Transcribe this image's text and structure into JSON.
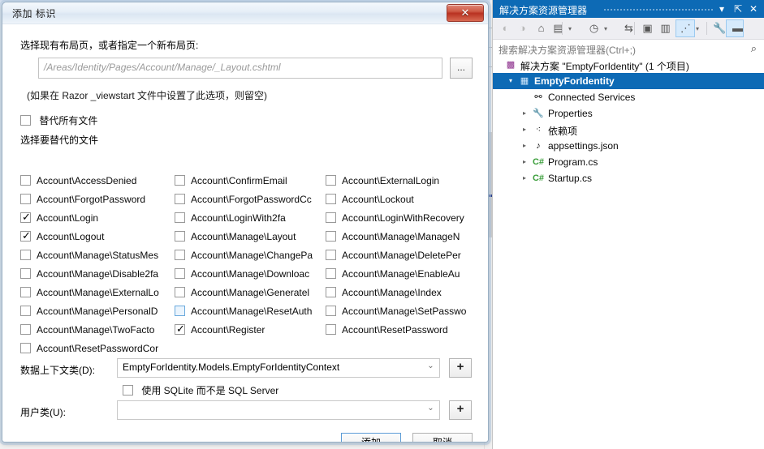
{
  "dialog": {
    "title": "添加 标识",
    "close_label": "✕",
    "layout_label": "选择现有布局页，或者指定一个新布局页:",
    "layout_placeholder": "/Areas/Identity/Pages/Account/Manage/_Layout.cshtml",
    "browse_label": "...",
    "layout_hint": "(如果在 Razor _viewstart 文件中设置了此选项，则留空)",
    "override_all_label": "替代所有文件",
    "override_all_checked": false,
    "select_files_label": "选择要替代的文件",
    "files": [
      {
        "label": "Account\\AccessDenied",
        "checked": false,
        "col": 0,
        "row": 0
      },
      {
        "label": "Account\\ForgotPassword",
        "checked": false,
        "col": 0,
        "row": 1
      },
      {
        "label": "Account\\Login",
        "checked": true,
        "col": 0,
        "row": 2
      },
      {
        "label": "Account\\Logout",
        "checked": true,
        "col": 0,
        "row": 3
      },
      {
        "label": "Account\\Manage\\StatusMes",
        "checked": false,
        "col": 0,
        "row": 4
      },
      {
        "label": "Account\\Manage\\Disable2fa",
        "checked": false,
        "col": 0,
        "row": 5
      },
      {
        "label": "Account\\Manage\\ExternalLo",
        "checked": false,
        "col": 0,
        "row": 6
      },
      {
        "label": "Account\\Manage\\PersonalD",
        "checked": false,
        "col": 0,
        "row": 7
      },
      {
        "label": "Account\\Manage\\TwoFacto",
        "checked": false,
        "col": 0,
        "row": 8
      },
      {
        "label": "Account\\ResetPasswordCor",
        "checked": false,
        "col": 0,
        "row": 9
      },
      {
        "label": "Account\\ConfirmEmail",
        "checked": false,
        "col": 1,
        "row": 0
      },
      {
        "label": "Account\\ForgotPasswordCc",
        "checked": false,
        "col": 1,
        "row": 1
      },
      {
        "label": "Account\\LoginWith2fa",
        "checked": false,
        "col": 1,
        "row": 2
      },
      {
        "label": "Account\\Manage\\Layout",
        "checked": false,
        "col": 1,
        "row": 3
      },
      {
        "label": "Account\\Manage\\ChangePa",
        "checked": false,
        "col": 1,
        "row": 4
      },
      {
        "label": "Account\\Manage\\Downloac",
        "checked": false,
        "col": 1,
        "row": 5
      },
      {
        "label": "Account\\Manage\\Generatel",
        "checked": false,
        "col": 1,
        "row": 6
      },
      {
        "label": "Account\\Manage\\ResetAuth",
        "checked": false,
        "col": 1,
        "row": 7,
        "focused": true
      },
      {
        "label": "Account\\Register",
        "checked": true,
        "col": 1,
        "row": 8
      },
      {
        "label": "Account\\ExternalLogin",
        "checked": false,
        "col": 2,
        "row": 0
      },
      {
        "label": "Account\\Lockout",
        "checked": false,
        "col": 2,
        "row": 1
      },
      {
        "label": "Account\\LoginWithRecovery",
        "checked": false,
        "col": 2,
        "row": 2
      },
      {
        "label": "Account\\Manage\\ManageN",
        "checked": false,
        "col": 2,
        "row": 3
      },
      {
        "label": "Account\\Manage\\DeletePer",
        "checked": false,
        "col": 2,
        "row": 4
      },
      {
        "label": "Account\\Manage\\EnableAu",
        "checked": false,
        "col": 2,
        "row": 5
      },
      {
        "label": "Account\\Manage\\Index",
        "checked": false,
        "col": 2,
        "row": 6
      },
      {
        "label": "Account\\Manage\\SetPasswo",
        "checked": false,
        "col": 2,
        "row": 7
      },
      {
        "label": "Account\\ResetPassword",
        "checked": false,
        "col": 2,
        "row": 8
      }
    ],
    "data_context_label": "数据上下文类(D):",
    "data_context_value": "EmptyForIdentity.Models.EmptyForIdentityContext",
    "data_context_add_label": "+",
    "sqlite_label": "使用 SQLite 而不是 SQL Server",
    "sqlite_checked": false,
    "user_class_label": "用户类(U):",
    "user_class_value": "",
    "user_class_add_label": "+",
    "add_button": "添加",
    "cancel_button": "取消",
    "combo_arrow": "⌄"
  },
  "solution_explorer": {
    "title": "解决方案资源管理器",
    "header_icons": {
      "dropdown": "▾",
      "pin": "⇱",
      "close": "✕"
    },
    "toolbar": [
      {
        "name": "back-icon",
        "glyph": "◐",
        "disabled": true
      },
      {
        "name": "forward-icon",
        "glyph": "◑",
        "disabled": true
      },
      {
        "name": "home-icon",
        "glyph": "⌂",
        "disabled": false
      },
      {
        "name": "pending-changes-icon",
        "glyph": "▤",
        "disabled": false
      },
      {
        "name": "pending-changes-caret",
        "glyph": "▾",
        "disabled": false
      },
      {
        "name": "history-icon",
        "glyph": "◷",
        "disabled": false
      },
      {
        "name": "history-caret",
        "glyph": "▾",
        "disabled": false
      },
      {
        "name": "sync-icon",
        "glyph": "⇆",
        "disabled": false
      },
      {
        "name": "collapse-all-icon",
        "glyph": "▣",
        "disabled": false
      },
      {
        "name": "show-all-files-icon",
        "glyph": "▥",
        "disabled": false
      },
      {
        "name": "view-designer-icon",
        "glyph": "⋰",
        "disabled": false
      },
      {
        "name": "view-designer-caret",
        "glyph": "▾",
        "disabled": false
      },
      {
        "name": "properties-icon",
        "glyph": "🔧",
        "disabled": false
      },
      {
        "name": "preview-selected-icon",
        "glyph": "▬",
        "disabled": false
      }
    ],
    "search_placeholder": "搜索解决方案资源管理器(Ctrl+;)",
    "search_icon": "⌕",
    "tree": [
      {
        "label": "解决方案 \"EmptyForIdentity\" (1 个项目)",
        "indent": 0,
        "expander": "",
        "icon": "sln-icon",
        "icon_glyph": "▩",
        "selected": false
      },
      {
        "label": "EmptyForIdentity",
        "indent": 1,
        "expander": "▾",
        "icon": "project-icon",
        "icon_glyph": "▦",
        "selected": true
      },
      {
        "label": "Connected Services",
        "indent": 2,
        "expander": "",
        "icon": "services-icon",
        "icon_glyph": "⚯",
        "selected": false
      },
      {
        "label": "Properties",
        "indent": 2,
        "expander": "▸",
        "icon": "wrench-icon",
        "icon_glyph": "🔧",
        "selected": false
      },
      {
        "label": "依赖项",
        "indent": 2,
        "expander": "▸",
        "icon": "dependency-icon",
        "icon_glyph": "⁖",
        "selected": false
      },
      {
        "label": "appsettings.json",
        "indent": 2,
        "expander": "▸",
        "icon": "json-icon",
        "icon_glyph": "♪",
        "selected": false
      },
      {
        "label": "Program.cs",
        "indent": 2,
        "expander": "▸",
        "icon": "csharp-icon",
        "icon_glyph": "C#",
        "selected": false
      },
      {
        "label": "Startup.cs",
        "indent": 2,
        "expander": "▸",
        "icon": "csharp-icon",
        "icon_glyph": "C#",
        "selected": false
      }
    ]
  },
  "colors": {
    "accent": "#0d6ab5",
    "close_red": "#b93221",
    "csharp_green": "#3a9e3a"
  }
}
